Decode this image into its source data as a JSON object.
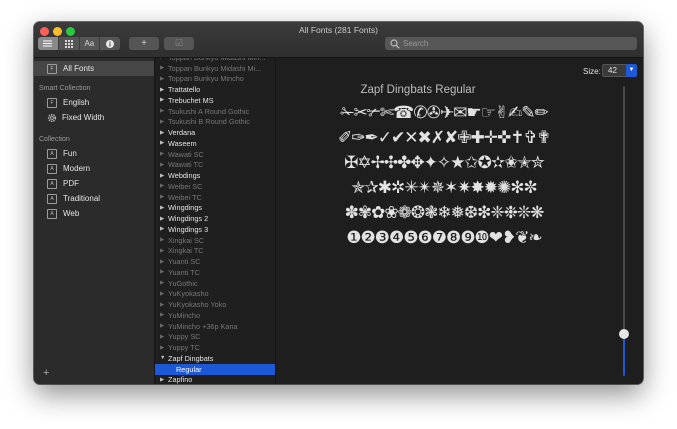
{
  "window": {
    "title": "All Fonts (281 Fonts)"
  },
  "toolbar": {
    "view_buttons": [
      "list-view",
      "grid-view",
      "Aa",
      "info"
    ],
    "add_label": "+",
    "validate_label": "☑"
  },
  "search": {
    "placeholder": "Search"
  },
  "sidebar": {
    "all_fonts": {
      "label": "All Fonts",
      "icon": "F"
    },
    "smart_heading": "Smart Collection",
    "smart": [
      {
        "label": "English",
        "icon": "F"
      },
      {
        "label": "Fixed Width",
        "icon": "gear-icon"
      }
    ],
    "collection_heading": "Collection",
    "collections": [
      {
        "label": "Fun",
        "icon": "A"
      },
      {
        "label": "Modern",
        "icon": "A"
      },
      {
        "label": "PDF",
        "icon": "A"
      },
      {
        "label": "Traditional",
        "icon": "A"
      },
      {
        "label": "Web",
        "icon": "A"
      }
    ],
    "add_label": "+"
  },
  "font_list": [
    {
      "label": "Toppan Bunkyu Midashi Min...",
      "dim": true
    },
    {
      "label": "Toppan Bunkyu Midashi Mi...",
      "dim": true
    },
    {
      "label": "Toppan Bunkyu Mincho",
      "dim": true
    },
    {
      "label": "Trattatello",
      "dim": false
    },
    {
      "label": "Trebuchet MS",
      "dim": false
    },
    {
      "label": "Tsukushi A Round Gothic",
      "dim": true
    },
    {
      "label": "Tsukushi B Round Gothic",
      "dim": true
    },
    {
      "label": "Verdana",
      "dim": false
    },
    {
      "label": "Waseem",
      "dim": false
    },
    {
      "label": "Wawati SC",
      "dim": true
    },
    {
      "label": "Wawati TC",
      "dim": true
    },
    {
      "label": "Webdings",
      "dim": false
    },
    {
      "label": "Weibei SC",
      "dim": true
    },
    {
      "label": "Weibei TC",
      "dim": true
    },
    {
      "label": "Wingdings",
      "dim": false
    },
    {
      "label": "Wingdings 2",
      "dim": false
    },
    {
      "label": "Wingdings 3",
      "dim": false
    },
    {
      "label": "Xingkai SC",
      "dim": true
    },
    {
      "label": "Xingkai TC",
      "dim": true
    },
    {
      "label": "Yuanti SC",
      "dim": true
    },
    {
      "label": "Yuanti TC",
      "dim": true
    },
    {
      "label": "YuGothic",
      "dim": true
    },
    {
      "label": "YuKyokasho",
      "dim": true
    },
    {
      "label": "YuKyokasho Yoko",
      "dim": true
    },
    {
      "label": "YuMincho",
      "dim": true
    },
    {
      "label": "YuMincho +36p Kana",
      "dim": true
    },
    {
      "label": "Yuppy SC",
      "dim": true
    },
    {
      "label": "Yuppy TC",
      "dim": true
    },
    {
      "label": "Zapf Dingbats",
      "dim": false,
      "expanded": true
    },
    {
      "label": "Regular",
      "dim": false,
      "sub": true,
      "selected": true
    },
    {
      "label": "Zapfino",
      "dim": false
    }
  ],
  "preview": {
    "font_name": "Zapf Dingbats Regular",
    "size_label": "Size:",
    "size_value": "42",
    "glyph_rows": [
      "✁✂✃✄☎✆✇✈✉☛☞✌✍✎✏",
      "✐✑✒✓✔✕✖✗✘✙✚✛✜✝✞✟",
      "✠✡✢✣✤✥✦✧★✩✪✫✬✭✮",
      "✯✰✱✲✳✴✵✶✷✸✹✺✻✼",
      "✽✾✿❀❁❂❃❄❅❆❇❈❉❊❋",
      "❶❷❸❹❺❻❼❽❾❿❤❥❦❧"
    ]
  },
  "colors": {
    "accent": "#1d58d6",
    "window_bg": "#1e1e1e",
    "sidebar_bg": "#2b2b2b"
  }
}
